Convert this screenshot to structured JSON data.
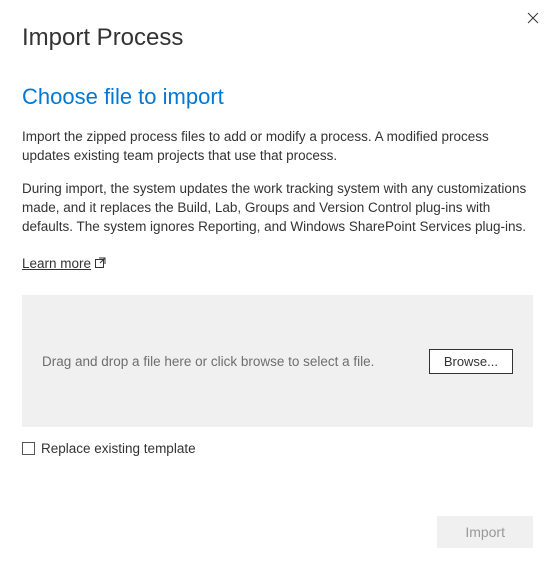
{
  "heading": "Import Process",
  "subheading": "Choose file to import",
  "description1": "Import the zipped process files to add or modify a process. A modified process updates existing team projects that use that process.",
  "description2": "During import, the system updates the work tracking system with any customizations made, and it replaces the Build, Lab, Groups and Version Control plug-ins with defaults. The system ignores Reporting, and Windows SharePoint Services plug-ins.",
  "learn_more": "Learn more",
  "dropzone_text": "Drag and drop a file here or click browse to select a file.",
  "browse_label": "Browse...",
  "checkbox_label": "Replace existing template",
  "import_label": "Import"
}
